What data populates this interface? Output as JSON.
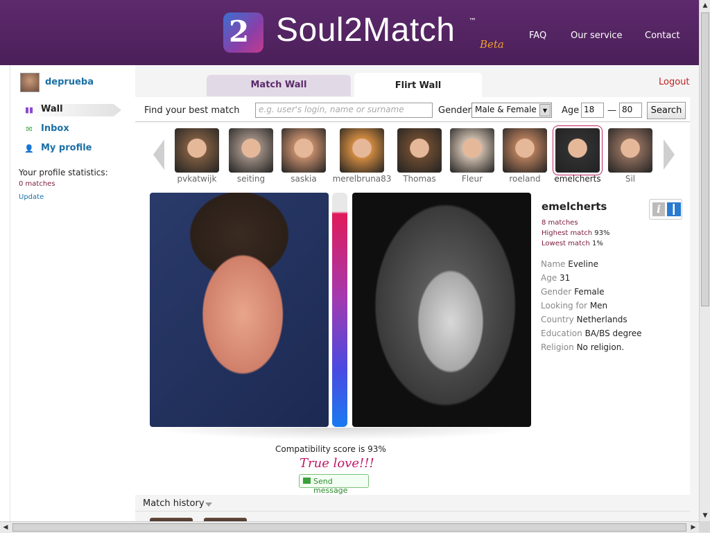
{
  "header": {
    "brand": "Soul2Match",
    "trademark": "™",
    "beta": "Beta",
    "logo_glyph": "2",
    "nav": [
      "FAQ",
      "Our service",
      "Contact"
    ]
  },
  "sidebar": {
    "username": "deprueba",
    "items": [
      {
        "label": "Wall",
        "icon": "wall-icon",
        "active": true
      },
      {
        "label": "Inbox",
        "icon": "envelope-icon",
        "active": false
      },
      {
        "label": "My profile",
        "icon": "person-icon",
        "active": false
      }
    ],
    "stats_title": "Your profile statistics:",
    "stats_value": "0 matches",
    "update_label": "Update"
  },
  "tabs": {
    "match_wall": "Match Wall",
    "flirt_wall": "Flirt Wall",
    "logout": "Logout"
  },
  "search": {
    "label": "Find your best match",
    "placeholder": "e.g. user's login, name or surname",
    "gender_label": "Gender",
    "gender_value": "Male & Female",
    "age_label": "Age",
    "age_min": "18",
    "age_dash": "—",
    "age_max": "80",
    "button": "Search"
  },
  "carousel": [
    {
      "name": "pvkatwijk",
      "color": "#7a5a40"
    },
    {
      "name": "seiting",
      "color": "#9a8a80"
    },
    {
      "name": "saskia",
      "color": "#c08a6a"
    },
    {
      "name": "merelbruna83",
      "color": "#d08a40"
    },
    {
      "name": "Thomas",
      "color": "#6a4a30"
    },
    {
      "name": "Fleur",
      "color": "#c8b8a8"
    },
    {
      "name": "roeland",
      "color": "#b07a5a"
    },
    {
      "name": "emelcherts",
      "color": "#303030",
      "selected": true
    },
    {
      "name": "Sil",
      "color": "#8a6a5a"
    }
  ],
  "profile": {
    "name": "emelcherts",
    "matches": "8 matches",
    "highest_label": "Highest match",
    "highest_value": "93%",
    "lowest_label": "Lowest match",
    "lowest_value": "1%",
    "fields": [
      {
        "k": "Name",
        "v": "Eveline"
      },
      {
        "k": "Age",
        "v": "31"
      },
      {
        "k": "Gender",
        "v": "Female"
      },
      {
        "k": "Looking for",
        "v": "Men"
      },
      {
        "k": "Country",
        "v": "Netherlands"
      },
      {
        "k": "Education",
        "v": "BA/BS degree"
      },
      {
        "k": "Religion",
        "v": "No religion."
      }
    ],
    "info_glyph": "i"
  },
  "compatibility": {
    "text": "Compatibility score is 93%",
    "score_percent": 93,
    "verdict": "True love!!!",
    "send_message": "Send message"
  },
  "history": {
    "label": "Match history"
  }
}
